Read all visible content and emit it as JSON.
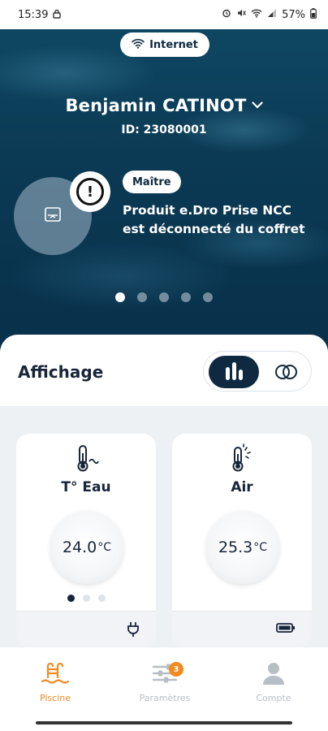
{
  "status_bar": {
    "time": "15:39",
    "battery": "57%",
    "icons": [
      "lock-icon",
      "alarm-icon",
      "mute-icon",
      "wifi-icon",
      "signal-icon",
      "battery-icon"
    ]
  },
  "connection": {
    "label": "Internet",
    "icon": "wifi-icon"
  },
  "user": {
    "name": "Benjamin CATINOT",
    "id_text": "ID: 23080001"
  },
  "alert": {
    "role": "Maître",
    "message": "Produit e.Dro Prise NCC est déconnecté du coffret",
    "icon": "exclamation-icon",
    "device_icon": "socket-icon"
  },
  "carousel": {
    "count": 5,
    "active_index": 0
  },
  "display": {
    "title": "Affichage",
    "active_view": "bars"
  },
  "cards": [
    {
      "label": "T° Eau",
      "value": "24.0",
      "unit": "°C",
      "icon": "water-thermometer-icon",
      "footer_icon": "plug-icon"
    },
    {
      "label": "Air",
      "value": "25.3",
      "unit": "°C",
      "icon": "sun-thermometer-icon",
      "footer_icon": "battery-icon"
    }
  ],
  "nav": {
    "items": [
      {
        "label": "Piscine",
        "icon": "pool-ladder-icon",
        "active": true
      },
      {
        "label": "Paramètres",
        "icon": "sliders-icon",
        "badge": "3"
      },
      {
        "label": "Compte",
        "icon": "user-icon"
      }
    ]
  },
  "colors": {
    "accent": "#f28a1e",
    "navy": "#0f2940",
    "water": "#0b3a54"
  }
}
